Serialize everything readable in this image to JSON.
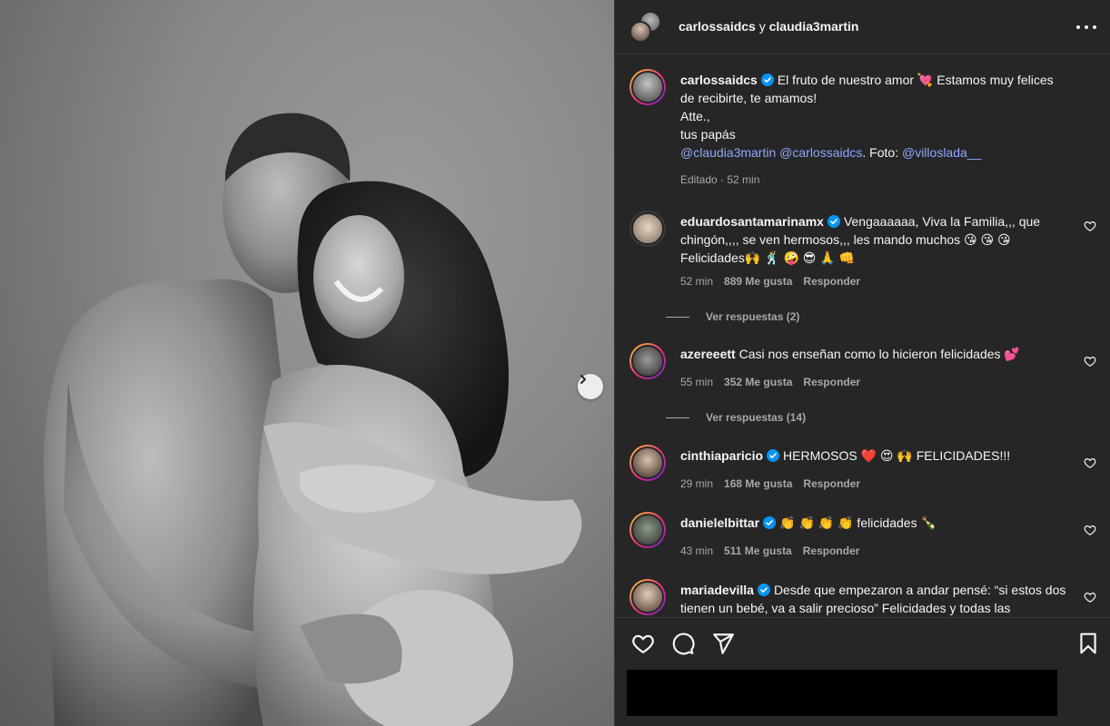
{
  "header": {
    "user1": "carlossaidcs",
    "joiner": " y ",
    "user2": "claudia3martin"
  },
  "caption": {
    "username": "carlossaidcs",
    "line1": "El fruto de nuestro amor 💘 Estamos muy felices de recibirte, te amamos!",
    "line2": "Atte.,",
    "line3": "tus papás",
    "mention1": "@claudia3martin",
    "mention2": "@carlossaidcs",
    "photo_credit_label": ". Foto: ",
    "mention3": "@villoslada__",
    "meta": "Editado · 52 min"
  },
  "comments": [
    {
      "username": "eduardosantamarinamx",
      "verified": true,
      "text": "Vengaaaaaa, Viva la Familia,,, que chingón,,,, se ven hermosos,,, les mando muchos 😘 😘 😘 Felicidades🙌 🕺 🤪 😎 🙏 👊",
      "time": "52 min",
      "likes": "889 Me gusta",
      "reply": "Responder",
      "view_replies": "Ver respuestas (2)"
    },
    {
      "username": "azereeett",
      "verified": false,
      "text": "Casi nos enseñan como lo hicieron felicidades 💕",
      "time": "55 min",
      "likes": "352 Me gusta",
      "reply": "Responder",
      "view_replies": "Ver respuestas (14)"
    },
    {
      "username": "cinthiaparicio",
      "verified": true,
      "text": "HERMOSOS ❤️ 😍 🙌 FELICIDADES!!!",
      "time": "29 min",
      "likes": "168 Me gusta",
      "reply": "Responder"
    },
    {
      "username": "danielelbittar",
      "verified": true,
      "text": "👏 👏 👏 👏 felicidades 🍾",
      "time": "43 min",
      "likes": "511 Me gusta",
      "reply": "Responder"
    },
    {
      "username": "mariadevilla",
      "verified": true,
      "text": "Desde que empezaron a andar pensé: “si estos dos tienen un bebé, va a salir precioso” Felicidades y todas las"
    }
  ],
  "icons": {
    "next": "chevron-right-icon",
    "more": "more-horizontal-icon",
    "like": "heart-icon",
    "comment": "comment-icon",
    "share": "send-icon",
    "save": "bookmark-icon"
  },
  "colors": {
    "panel_bg": "#262626",
    "link": "#8ea8ff",
    "verified": "#0095f6",
    "muted": "#a8a8a8"
  }
}
